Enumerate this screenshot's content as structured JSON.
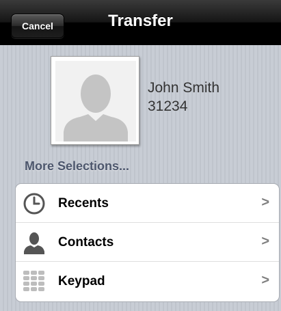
{
  "navbar": {
    "title": "Transfer",
    "cancel_label": "Cancel"
  },
  "contact": {
    "name": "John Smith",
    "number": "31234"
  },
  "section": {
    "header": "More Selections..."
  },
  "menu": {
    "items": [
      {
        "label": "Recents",
        "icon": "clock-icon",
        "chevron": ">"
      },
      {
        "label": "Contacts",
        "icon": "person-icon",
        "chevron": ">"
      },
      {
        "label": "Keypad",
        "icon": "keypad-icon",
        "chevron": ">"
      }
    ]
  },
  "colors": {
    "navbar": "#000000",
    "background": "#c5cad2",
    "section_header": "#4c566c",
    "chevron": "#7f7f7f"
  }
}
